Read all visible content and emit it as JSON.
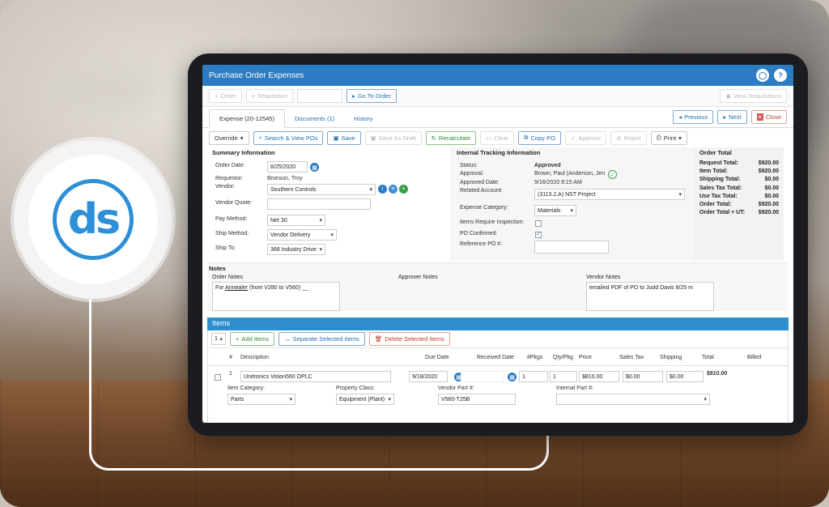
{
  "window": {
    "title": "Purchase Order Expenses"
  },
  "toolbar1": {
    "order": "Order",
    "requisition": "Requisition",
    "goto": "Go To Order",
    "view_req": "View Requisitions"
  },
  "tabs": [
    {
      "label": "Expense (20-12545)"
    },
    {
      "label": "Documents (1)"
    },
    {
      "label": "History"
    }
  ],
  "nav": {
    "previous": "Previous",
    "next": "Next",
    "close": "Close"
  },
  "toolbar2": {
    "override": "Override",
    "search": "Search & View POs",
    "save": "Save",
    "save_draft": "Save As Draft",
    "recalculate": "Recalculate",
    "clear": "Clear",
    "copy": "Copy PO",
    "approve": "Approve",
    "reject": "Reject",
    "print": "Print"
  },
  "summary": {
    "title": "Summary Information",
    "order_date_label": "Order Date:",
    "order_date": "8/25/2020",
    "requestor_label": "Requestor:",
    "requestor": "Bronson, Troy",
    "vendor_label": "Vendor:",
    "vendor": "Southern Controls",
    "vendor_quote_label": "Vendor Quote:",
    "pay_method_label": "Pay Method:",
    "pay_method": "Net 30",
    "ship_method_label": "Ship Method:",
    "ship_method": "Vendor Delivery",
    "ship_to_label": "Ship To:",
    "ship_to": "368 Industry Drive"
  },
  "tracking": {
    "title": "Internal Tracking Information",
    "status_label": "Status:",
    "status": "Approved",
    "approval_label": "Approval:",
    "approval": "Brown, Paul (Anderson, Jen",
    "approved_date_label": "Approved Date:",
    "approved_date": "9/16/2020 8:15 AM",
    "related_label": "Related Account:",
    "related": "(3113.2.A) NST Project",
    "category_label": "Expense Category:",
    "category": "Materials",
    "inspection_label": "Items Require Inspection:",
    "confirmed_label": "PO Confirmed:",
    "ref_label": "Reference PO #:"
  },
  "order_total": {
    "title": "Order Total",
    "rows": [
      {
        "label": "Request Total:",
        "value": "$920.00"
      },
      {
        "label": "Item Total:",
        "value": "$920.00"
      },
      {
        "label": "Shipping Total:",
        "value": "$0.00"
      },
      {
        "label": "Sales Tax Total:",
        "value": "$0.00"
      },
      {
        "label": "Use Tax Total:",
        "value": "$0.00"
      },
      {
        "label": "Order Total:",
        "value": "$920.00"
      },
      {
        "label": "Order Total + UT:",
        "value": "$920.00"
      }
    ]
  },
  "notes": {
    "title": "Notes",
    "order_label": "Order Notes",
    "order_pre": "For ",
    "order_link": "Annealer",
    "order_post": " (from V280 to V560) __",
    "approver_label": "Approver Notes",
    "vendor_label": "Vendor Notes",
    "vendor_text": "emailed PDF of PO to Judd Davis 8/25 m"
  },
  "items": {
    "title": "Items",
    "page_size": "1",
    "add": "Add Items",
    "separate": "Separate Selected Items",
    "delete": "Delete Selected Items",
    "headers": {
      "num": "#",
      "desc": "Description",
      "due": "Due Date",
      "received": "Received Date",
      "pkgs": "#Pkgs",
      "qty": "Qty/Pkg",
      "price": "Price",
      "tax": "Sales Tax",
      "shipping": "Shipping",
      "total": "Total",
      "billed": "Billed"
    },
    "row": {
      "num": "1",
      "desc": "Unitronics Vision560 OPLC",
      "due": "9/18/2020",
      "pkgs": "1",
      "qty": "1",
      "price": "$810.00",
      "tax": "$0.00",
      "shipping": "$0.00",
      "total": "$810.00",
      "cat_label": "Item Category:",
      "cat": "Parts",
      "prop_label": "Property Class:",
      "prop": "Equipment (Plant)",
      "vpart_label": "Vendor Part #:",
      "vpart": "V560-T25B",
      "ipart_label": "Internal Part #:"
    }
  }
}
